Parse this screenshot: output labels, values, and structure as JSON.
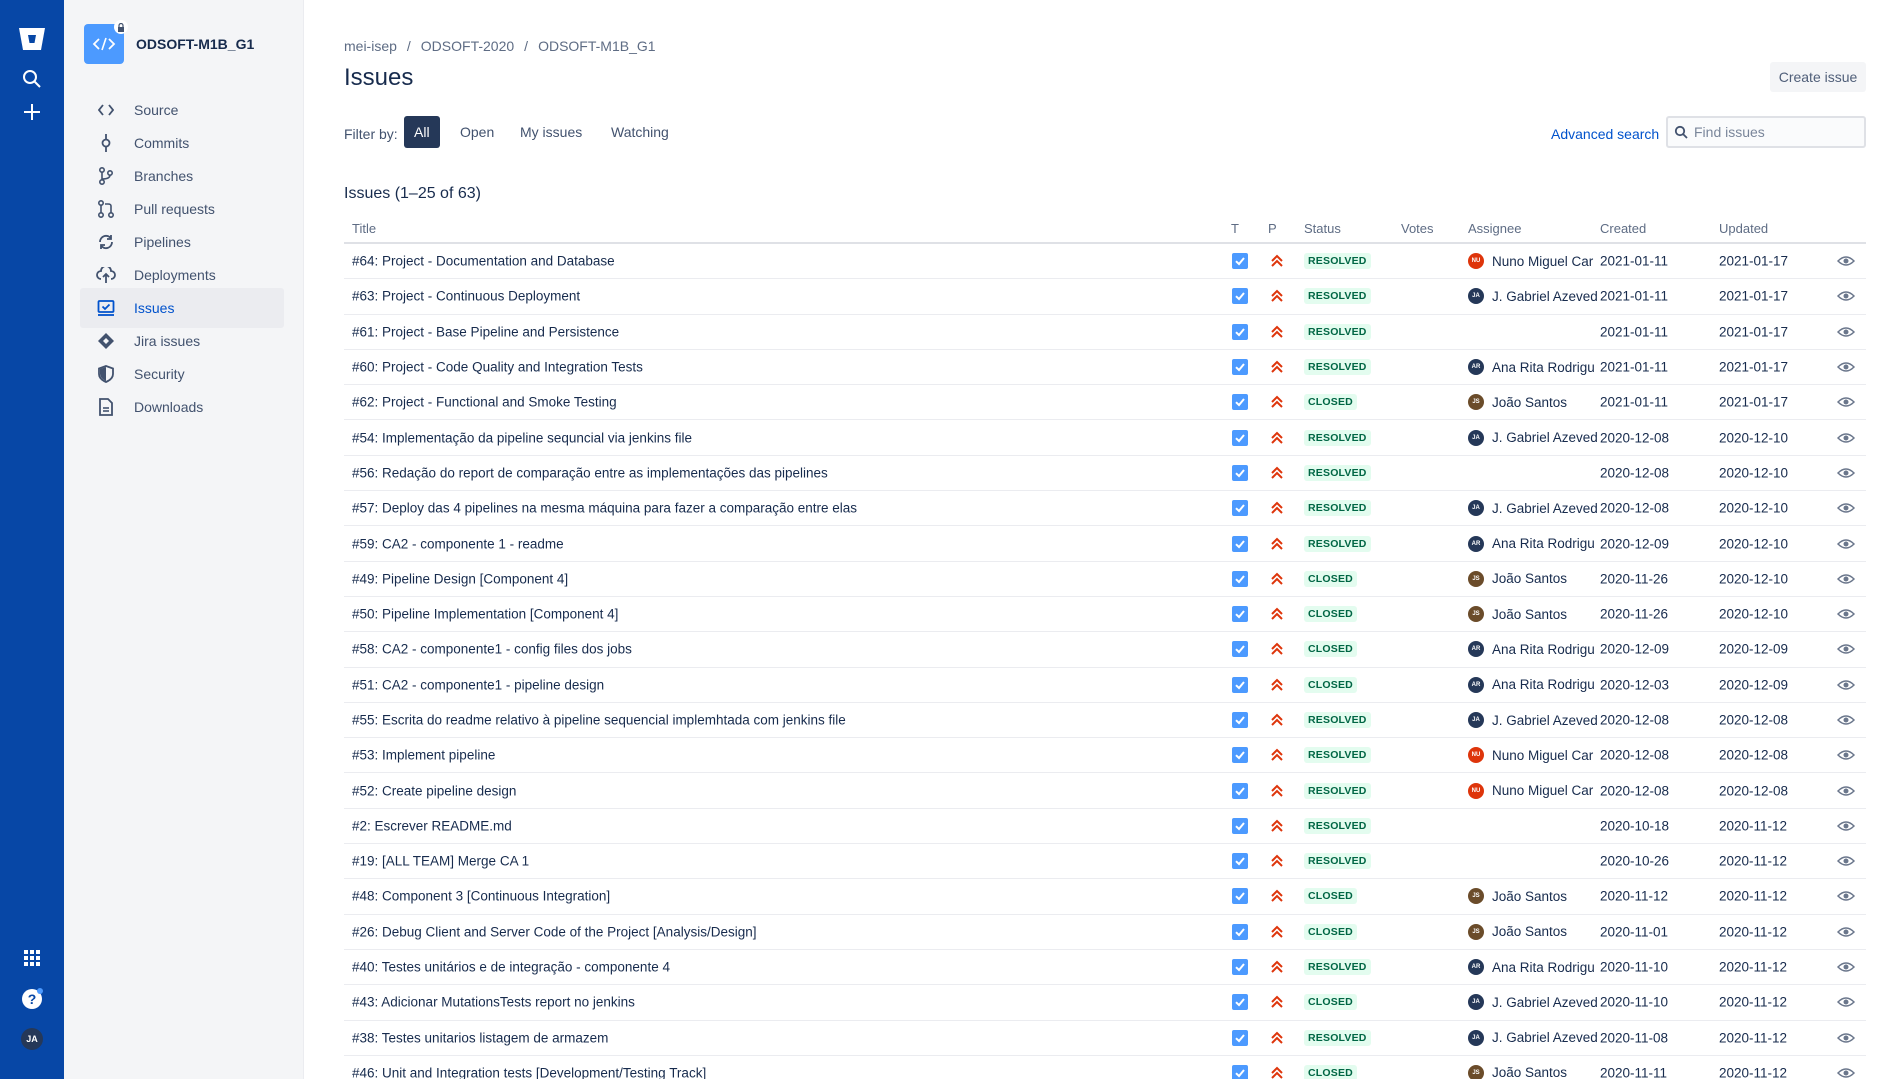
{
  "global_nav": {
    "icons": [
      "bitbucket-logo-icon",
      "search-icon",
      "plus-icon",
      "app-switcher-icon",
      "help-icon"
    ],
    "user_avatar_initials": "JA"
  },
  "repo": {
    "name": "ODSOFT-M1B_G1"
  },
  "sidebar": {
    "items": [
      {
        "label": "Source",
        "icon": "source-icon"
      },
      {
        "label": "Commits",
        "icon": "commits-icon"
      },
      {
        "label": "Branches",
        "icon": "branches-icon"
      },
      {
        "label": "Pull requests",
        "icon": "pull-requests-icon"
      },
      {
        "label": "Pipelines",
        "icon": "pipelines-icon"
      },
      {
        "label": "Deployments",
        "icon": "deployments-icon"
      },
      {
        "label": "Issues",
        "icon": "issues-icon",
        "active": true
      },
      {
        "label": "Jira issues",
        "icon": "jira-icon"
      },
      {
        "label": "Security",
        "icon": "shield-icon"
      },
      {
        "label": "Downloads",
        "icon": "downloads-icon"
      }
    ]
  },
  "breadcrumb": [
    "mei-isep",
    "ODSOFT-2020",
    "ODSOFT-M1B_G1"
  ],
  "page_title": "Issues",
  "create_issue_label": "Create issue",
  "filter": {
    "label": "Filter by:",
    "options": [
      "All",
      "Open",
      "My issues",
      "Watching"
    ],
    "selected": "All"
  },
  "advanced_search_label": "Advanced search",
  "search": {
    "placeholder": "Find issues",
    "value": ""
  },
  "issues_count": "Issues (1–25 of 63)",
  "table": {
    "headers": {
      "title": "Title",
      "type": "T",
      "priority": "P",
      "status": "Status",
      "votes": "Votes",
      "assignee": "Assignee",
      "created": "Created",
      "updated": "Updated"
    },
    "rows": [
      {
        "title": "#64: Project - Documentation and Database",
        "status": "RESOLVED",
        "assignee": "Nuno Miguel Car",
        "avatar": "NU",
        "created": "2021-01-11",
        "updated": "2021-01-17"
      },
      {
        "title": "#63: Project - Continuous Deployment",
        "status": "RESOLVED",
        "assignee": "J. Gabriel Azeved",
        "avatar": "JA",
        "created": "2021-01-11",
        "updated": "2021-01-17"
      },
      {
        "title": "#61: Project - Base Pipeline and Persistence",
        "status": "RESOLVED",
        "assignee": "",
        "avatar": "",
        "created": "2021-01-11",
        "updated": "2021-01-17"
      },
      {
        "title": "#60: Project - Code Quality and Integration Tests",
        "status": "RESOLVED",
        "assignee": "Ana Rita Rodrigu",
        "avatar": "AR",
        "created": "2021-01-11",
        "updated": "2021-01-17"
      },
      {
        "title": "#62: Project - Functional and Smoke Testing",
        "status": "CLOSED",
        "assignee": "João Santos",
        "avatar": "JS",
        "created": "2021-01-11",
        "updated": "2021-01-17"
      },
      {
        "title": "#54: Implementação da pipeline sequncial via jenkins file",
        "status": "RESOLVED",
        "assignee": "J. Gabriel Azeved",
        "avatar": "JA",
        "created": "2020-12-08",
        "updated": "2020-12-10"
      },
      {
        "title": "#56: Redação do report de comparação entre as implementações das pipelines",
        "status": "RESOLVED",
        "assignee": "",
        "avatar": "",
        "created": "2020-12-08",
        "updated": "2020-12-10"
      },
      {
        "title": "#57: Deploy das 4 pipelines na mesma máquina para fazer a comparação entre elas",
        "status": "RESOLVED",
        "assignee": "J. Gabriel Azeved",
        "avatar": "JA",
        "created": "2020-12-08",
        "updated": "2020-12-10"
      },
      {
        "title": "#59: CA2 - componente 1 - readme",
        "status": "RESOLVED",
        "assignee": "Ana Rita Rodrigu",
        "avatar": "AR",
        "created": "2020-12-09",
        "updated": "2020-12-10"
      },
      {
        "title": "#49: Pipeline Design [Component 4]",
        "status": "CLOSED",
        "assignee": "João Santos",
        "avatar": "JS",
        "created": "2020-11-26",
        "updated": "2020-12-10"
      },
      {
        "title": "#50: Pipeline Implementation [Component 4]",
        "status": "CLOSED",
        "assignee": "João Santos",
        "avatar": "JS",
        "created": "2020-11-26",
        "updated": "2020-12-10"
      },
      {
        "title": "#58: CA2 - componente1 - config files dos jobs",
        "status": "CLOSED",
        "assignee": "Ana Rita Rodrigu",
        "avatar": "AR",
        "created": "2020-12-09",
        "updated": "2020-12-09"
      },
      {
        "title": "#51: CA2 - componente1 - pipeline design",
        "status": "CLOSED",
        "assignee": "Ana Rita Rodrigu",
        "avatar": "AR",
        "created": "2020-12-03",
        "updated": "2020-12-09"
      },
      {
        "title": "#55: Escrita do readme relativo à pipeline sequencial implemhtada com jenkins file",
        "status": "RESOLVED",
        "assignee": "J. Gabriel Azeved",
        "avatar": "JA",
        "created": "2020-12-08",
        "updated": "2020-12-08"
      },
      {
        "title": "#53: Implement pipeline",
        "status": "RESOLVED",
        "assignee": "Nuno Miguel Car",
        "avatar": "NU",
        "created": "2020-12-08",
        "updated": "2020-12-08"
      },
      {
        "title": "#52: Create pipeline design",
        "status": "RESOLVED",
        "assignee": "Nuno Miguel Car",
        "avatar": "NU",
        "created": "2020-12-08",
        "updated": "2020-12-08"
      },
      {
        "title": "#2: Escrever README.md",
        "status": "RESOLVED",
        "assignee": "",
        "avatar": "",
        "created": "2020-10-18",
        "updated": "2020-11-12"
      },
      {
        "title": "#19: [ALL TEAM] Merge CA 1",
        "status": "RESOLVED",
        "assignee": "",
        "avatar": "",
        "created": "2020-10-26",
        "updated": "2020-11-12"
      },
      {
        "title": "#48: Component 3 [Continuous Integration]",
        "status": "CLOSED",
        "assignee": "João Santos",
        "avatar": "JS",
        "created": "2020-11-12",
        "updated": "2020-11-12"
      },
      {
        "title": "#26: Debug Client and Server Code of the Project [Analysis/Design]",
        "status": "CLOSED",
        "assignee": "João Santos",
        "avatar": "JS",
        "created": "2020-11-01",
        "updated": "2020-11-12"
      },
      {
        "title": "#40: Testes unitários e de integração - componente 4",
        "status": "RESOLVED",
        "assignee": "Ana Rita Rodrigu",
        "avatar": "AR",
        "created": "2020-11-10",
        "updated": "2020-11-12"
      },
      {
        "title": "#43: Adicionar MutationsTests report no jenkins",
        "status": "CLOSED",
        "assignee": "J. Gabriel Azeved",
        "avatar": "JA",
        "created": "2020-11-10",
        "updated": "2020-11-12"
      },
      {
        "title": "#38: Testes unitarios listagem de armazem",
        "status": "RESOLVED",
        "assignee": "J. Gabriel Azeved",
        "avatar": "JA",
        "created": "2020-11-08",
        "updated": "2020-11-12"
      },
      {
        "title": "#46: Unit and Integration tests [Development/Testing Track]",
        "status": "CLOSED",
        "assignee": "João Santos",
        "avatar": "JS",
        "created": "2020-11-11",
        "updated": "2020-11-12"
      }
    ]
  },
  "colors": {
    "global_nav": "#0747A6",
    "accent": "#0052CC",
    "priority": "#DE350B",
    "type_task": "#4C9AFF"
  }
}
